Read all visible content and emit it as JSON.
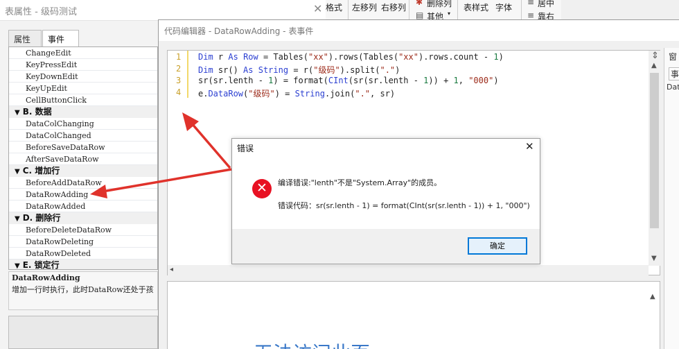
{
  "prop_window": {
    "title": "表属性 - 级码测试",
    "close_glyph": "✕",
    "tabs": {
      "properties": "属性",
      "events": "事件"
    }
  },
  "event_list": {
    "rows": [
      {
        "type": "item",
        "label": "ChangeEdit"
      },
      {
        "type": "item",
        "label": "KeyPressEdit"
      },
      {
        "type": "item",
        "label": "KeyDownEdit"
      },
      {
        "type": "item",
        "label": "KeyUpEdit"
      },
      {
        "type": "item",
        "label": "CellButtonClick"
      },
      {
        "type": "group",
        "label": "B. 数据"
      },
      {
        "type": "item",
        "label": "DataColChanging"
      },
      {
        "type": "item",
        "label": "DataColChanged"
      },
      {
        "type": "item",
        "label": "BeforeSaveDataRow"
      },
      {
        "type": "item",
        "label": "AfterSaveDataRow"
      },
      {
        "type": "group",
        "label": "C. 增加行"
      },
      {
        "type": "item",
        "label": "BeforeAddDataRow"
      },
      {
        "type": "item",
        "label": "DataRowAdding",
        "selected": true
      },
      {
        "type": "item",
        "label": "DataRowAdded"
      },
      {
        "type": "group",
        "label": "D. 删除行"
      },
      {
        "type": "item",
        "label": "BeforeDeleteDataRow"
      },
      {
        "type": "item",
        "label": "DataRowDeleting"
      },
      {
        "type": "item",
        "label": "DataRowDeleted"
      },
      {
        "type": "group",
        "label": "E. 锁定行"
      }
    ]
  },
  "description": {
    "title": "DataRowAdding",
    "text": "增加一行时执行，此时DataRow还处于孩"
  },
  "ribbon": {
    "items": [
      "格式",
      "左移列",
      "右移列",
      "删除列",
      "其他",
      "表样式",
      "字体",
      "居中",
      "靠右"
    ]
  },
  "editor": {
    "title": "代码编辑器 - DataRowAdding - 表事件",
    "line_numbers": [
      "1",
      "2",
      "3",
      "4"
    ],
    "preview_text": "无法访问此页",
    "right_panel": {
      "window_label": "窗",
      "events_label": "事件",
      "data_label": "Dat"
    }
  },
  "dialog": {
    "title": "错误",
    "close_glyph": "✕",
    "icon": "error-icon",
    "message": "编译错误:\"lenth\"不是\"System.Array\"的成员。",
    "error_code": "错误代码：sr(sr.lenth - 1) = format(CInt(sr(sr.lenth - 1)) + 1, \"000\")",
    "ok_label": "确定"
  },
  "colors": {
    "arrow": "#e0322b",
    "error_icon": "#e81123",
    "accent": "#0078d7"
  }
}
